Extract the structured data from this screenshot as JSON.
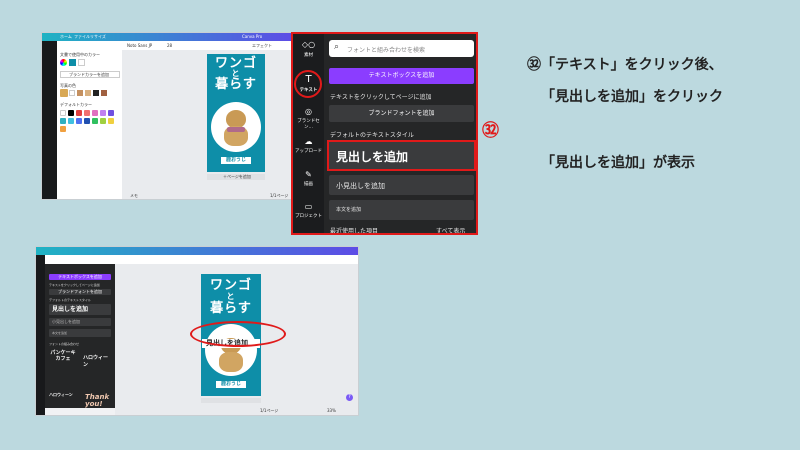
{
  "callouts": {
    "line1": "㉜「テキスト」をクリック後、",
    "line2": "「見出しを追加」をクリック",
    "line3": "「見出しを追加」が表示",
    "marker": "㉜"
  },
  "top_editor": {
    "header": {
      "home": "ホーム",
      "file": "ファイル",
      "resize": "リサイズ",
      "canva_pro": "Canva Pro"
    },
    "toolbar": {
      "font": "Noto Sans JP",
      "size": "28",
      "effects": "エフェクト"
    },
    "left_panel": {
      "document_colors": "文書で使用中のカラー",
      "brand_kit": "ブランドカラーを追加",
      "photo_colors": "写真の色",
      "default_colors": "デフォルトカラー"
    },
    "poster": {
      "title_line1": "ワンゴ",
      "title_line2": "と",
      "title_line3": "暮らす",
      "name": "鹿おうじ"
    },
    "add_page": "＋ページを追加",
    "status": {
      "notes": "メモ",
      "pages": "1/1ページ"
    },
    "swatch_colors": [
      "#ffffff",
      "#000000",
      "#e04040",
      "#f07070",
      "#e070c0",
      "#c080f0",
      "#7050e0",
      "#30b0c0",
      "#40c0e0",
      "#5070f0",
      "#2050b0",
      "#30c060",
      "#a0d040",
      "#f0d040",
      "#f0a040"
    ]
  },
  "zoom_panel": {
    "rail": [
      {
        "label": "素材",
        "icon": "shapes-icon"
      },
      {
        "label": "テキスト",
        "icon": "text-icon"
      },
      {
        "label": "ブランドセン…",
        "icon": "brand-icon"
      },
      {
        "label": "アップロード",
        "icon": "upload-icon"
      },
      {
        "label": "描画",
        "icon": "draw-icon"
      },
      {
        "label": "プロジェクト",
        "icon": "folder-icon"
      }
    ],
    "search_placeholder": "フォントと組み合わせを検索",
    "add_textbox": "テキストボックスを追加",
    "click_to_add": "テキストをクリックしてページに追加",
    "brand_fonts": "ブランドフォントを追加",
    "default_styles": "デフォルトのテキストスタイル",
    "add_heading": "見出しを追加",
    "add_subheading": "小見出しを追加",
    "add_body": "本文を追加",
    "recently_used": "最近使用した項目",
    "see_all": "すべて表示"
  },
  "bottom_editor": {
    "panel": {
      "add_textbox": "テキストボックスを追加",
      "click_to_add": "テキストをクリックしてページに追加",
      "brand_fonts": "ブランドフォントを追加",
      "default_styles": "デフォルトのテキストスタイル",
      "add_heading": "見出しを追加",
      "add_subheading": "小見出しを追加",
      "add_body": "本文を追加",
      "combinations": "フォントの組み合わせ",
      "sample1": "パンケーキカフェ",
      "sample2": "ハロウィーン",
      "sample3": "Thank you!"
    },
    "poster": {
      "title_line1": "ワンゴ",
      "title_line2": "と",
      "title_line3": "暮らす",
      "heading_added": "見出しを追加",
      "name": "鹿おうじ"
    },
    "status": {
      "pages": "1/1ページ",
      "zoom": "33%"
    }
  }
}
